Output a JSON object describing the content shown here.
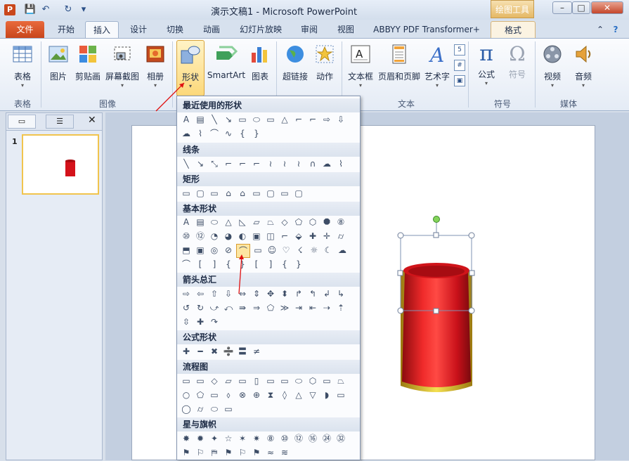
{
  "window": {
    "title": "演示文稿1 - Microsoft PowerPoint",
    "context_tab_group": "绘图工具",
    "controls": [
      "–",
      "□",
      "✕"
    ]
  },
  "quick_access": {
    "app_icon": "P",
    "save": "💾",
    "undo": "↶",
    "redo": "↻",
    "customize": "▾"
  },
  "tabs": [
    "文件",
    "开始",
    "插入",
    "设计",
    "切换",
    "动画",
    "幻灯片放映",
    "审阅",
    "视图",
    "ABBYY PDF Transformer+",
    "格式"
  ],
  "ribbon": {
    "groups": {
      "table": "表格",
      "images": "图像",
      "text": "文本",
      "symbols": "符号",
      "media": "媒体"
    },
    "buttons": {
      "table": "表格",
      "picture": "图片",
      "clipart": "剪贴画",
      "screenshot": "屏幕截图",
      "album": "相册",
      "shapes": "形状",
      "smartart": "SmartArt",
      "chart": "图表",
      "hyperlink": "超链接",
      "action": "动作",
      "textbox": "文本框",
      "header_footer": "页眉和页脚",
      "wordart": "艺术字",
      "equation": "公式",
      "symbol": "符号",
      "video": "视频",
      "audio": "音频"
    }
  },
  "slides_pane": {
    "slide_number": "1"
  },
  "shapes_menu": {
    "sections": {
      "recent": "最近使用的形状",
      "lines": "线条",
      "rectangles": "矩形",
      "basic": "基本形状",
      "arrows": "箭头总汇",
      "equation": "公式形状",
      "flowchart": "流程图",
      "stars": "星与旗帜"
    },
    "rows": {
      "recent1": [
        "A",
        "▤",
        "╲",
        "↘",
        "▭",
        "⬭",
        "▭",
        "△",
        "⌐",
        "⌐",
        "⇨",
        "⇩"
      ],
      "recent2": [
        "☁",
        "⌇",
        "⌒",
        "∿",
        "{",
        "}"
      ],
      "lines1": [
        "╲",
        "↘",
        "⤡",
        "⌐",
        "⌐",
        "⌐",
        "≀",
        "≀",
        "≀",
        "∩",
        "☁",
        "⌇"
      ],
      "rect1": [
        "▭",
        "▢",
        "▭",
        "⌂",
        "⌂",
        "▭",
        "▢",
        "▭",
        "▢"
      ],
      "basic1": [
        "A",
        "▤",
        "⬭",
        "△",
        "◺",
        "▱",
        "⏢",
        "◇",
        "⬠",
        "⬡",
        "⯃",
        "⑧"
      ],
      "basic2": [
        "⑩",
        "⑫",
        "◔",
        "◕",
        "◐",
        "▣",
        "◫",
        "⌐",
        "⬙",
        "✚",
        "✛",
        "⌭"
      ],
      "basic3": [
        "⬒",
        "▣",
        "◎",
        "⊘",
        "⌒",
        "▭",
        "☺",
        "♡",
        "☇",
        "☼",
        "☾",
        "☁"
      ],
      "basic4": [
        "⌒",
        "[",
        "]",
        "{",
        "}",
        "[",
        "]",
        "{",
        "}"
      ],
      "arrows1": [
        "⇨",
        "⇦",
        "⇧",
        "⇩",
        "⇔",
        "⇕",
        "✥",
        "⬍",
        "↱",
        "↰",
        "↲",
        "↳"
      ],
      "arrows2": [
        "↺",
        "↻",
        "⤻",
        "⤺",
        "⇛",
        "⇒",
        "⬠",
        "≫",
        "⇥",
        "⇤",
        "⇢",
        "⇡"
      ],
      "arrows3": [
        "⇳",
        "✚",
        "↷"
      ],
      "eq1": [
        "✚",
        "━",
        "✖",
        "➗",
        "〓",
        "≠"
      ],
      "flow1": [
        "▭",
        "▭",
        "◇",
        "▱",
        "▭",
        "▯",
        "▭",
        "▭",
        "⬭",
        "⬡",
        "▭",
        "⏢"
      ],
      "flow2": [
        "○",
        "⬠",
        "▭",
        "⬨",
        "⊗",
        "⊕",
        "⧗",
        "◊",
        "△",
        "▽",
        "◗",
        "▭"
      ],
      "flow3": [
        "◯",
        "⌭",
        "⬭",
        "▭"
      ],
      "stars1": [
        "✸",
        "✹",
        "✦",
        "☆",
        "✶",
        "✷",
        "⑧",
        "⑩",
        "⑫",
        "⑯",
        "㉔",
        "㉜"
      ],
      "stars2": [
        "⚑",
        "⚐",
        "⛿",
        "⚑",
        "⚐",
        "⚑",
        "≈",
        "≋"
      ]
    }
  },
  "colors": {
    "accent_orange": "#e96a3c",
    "shape_red": "#e0141a",
    "shape_gold": "#e0c020",
    "hover_yellow": "#fcd87a"
  }
}
